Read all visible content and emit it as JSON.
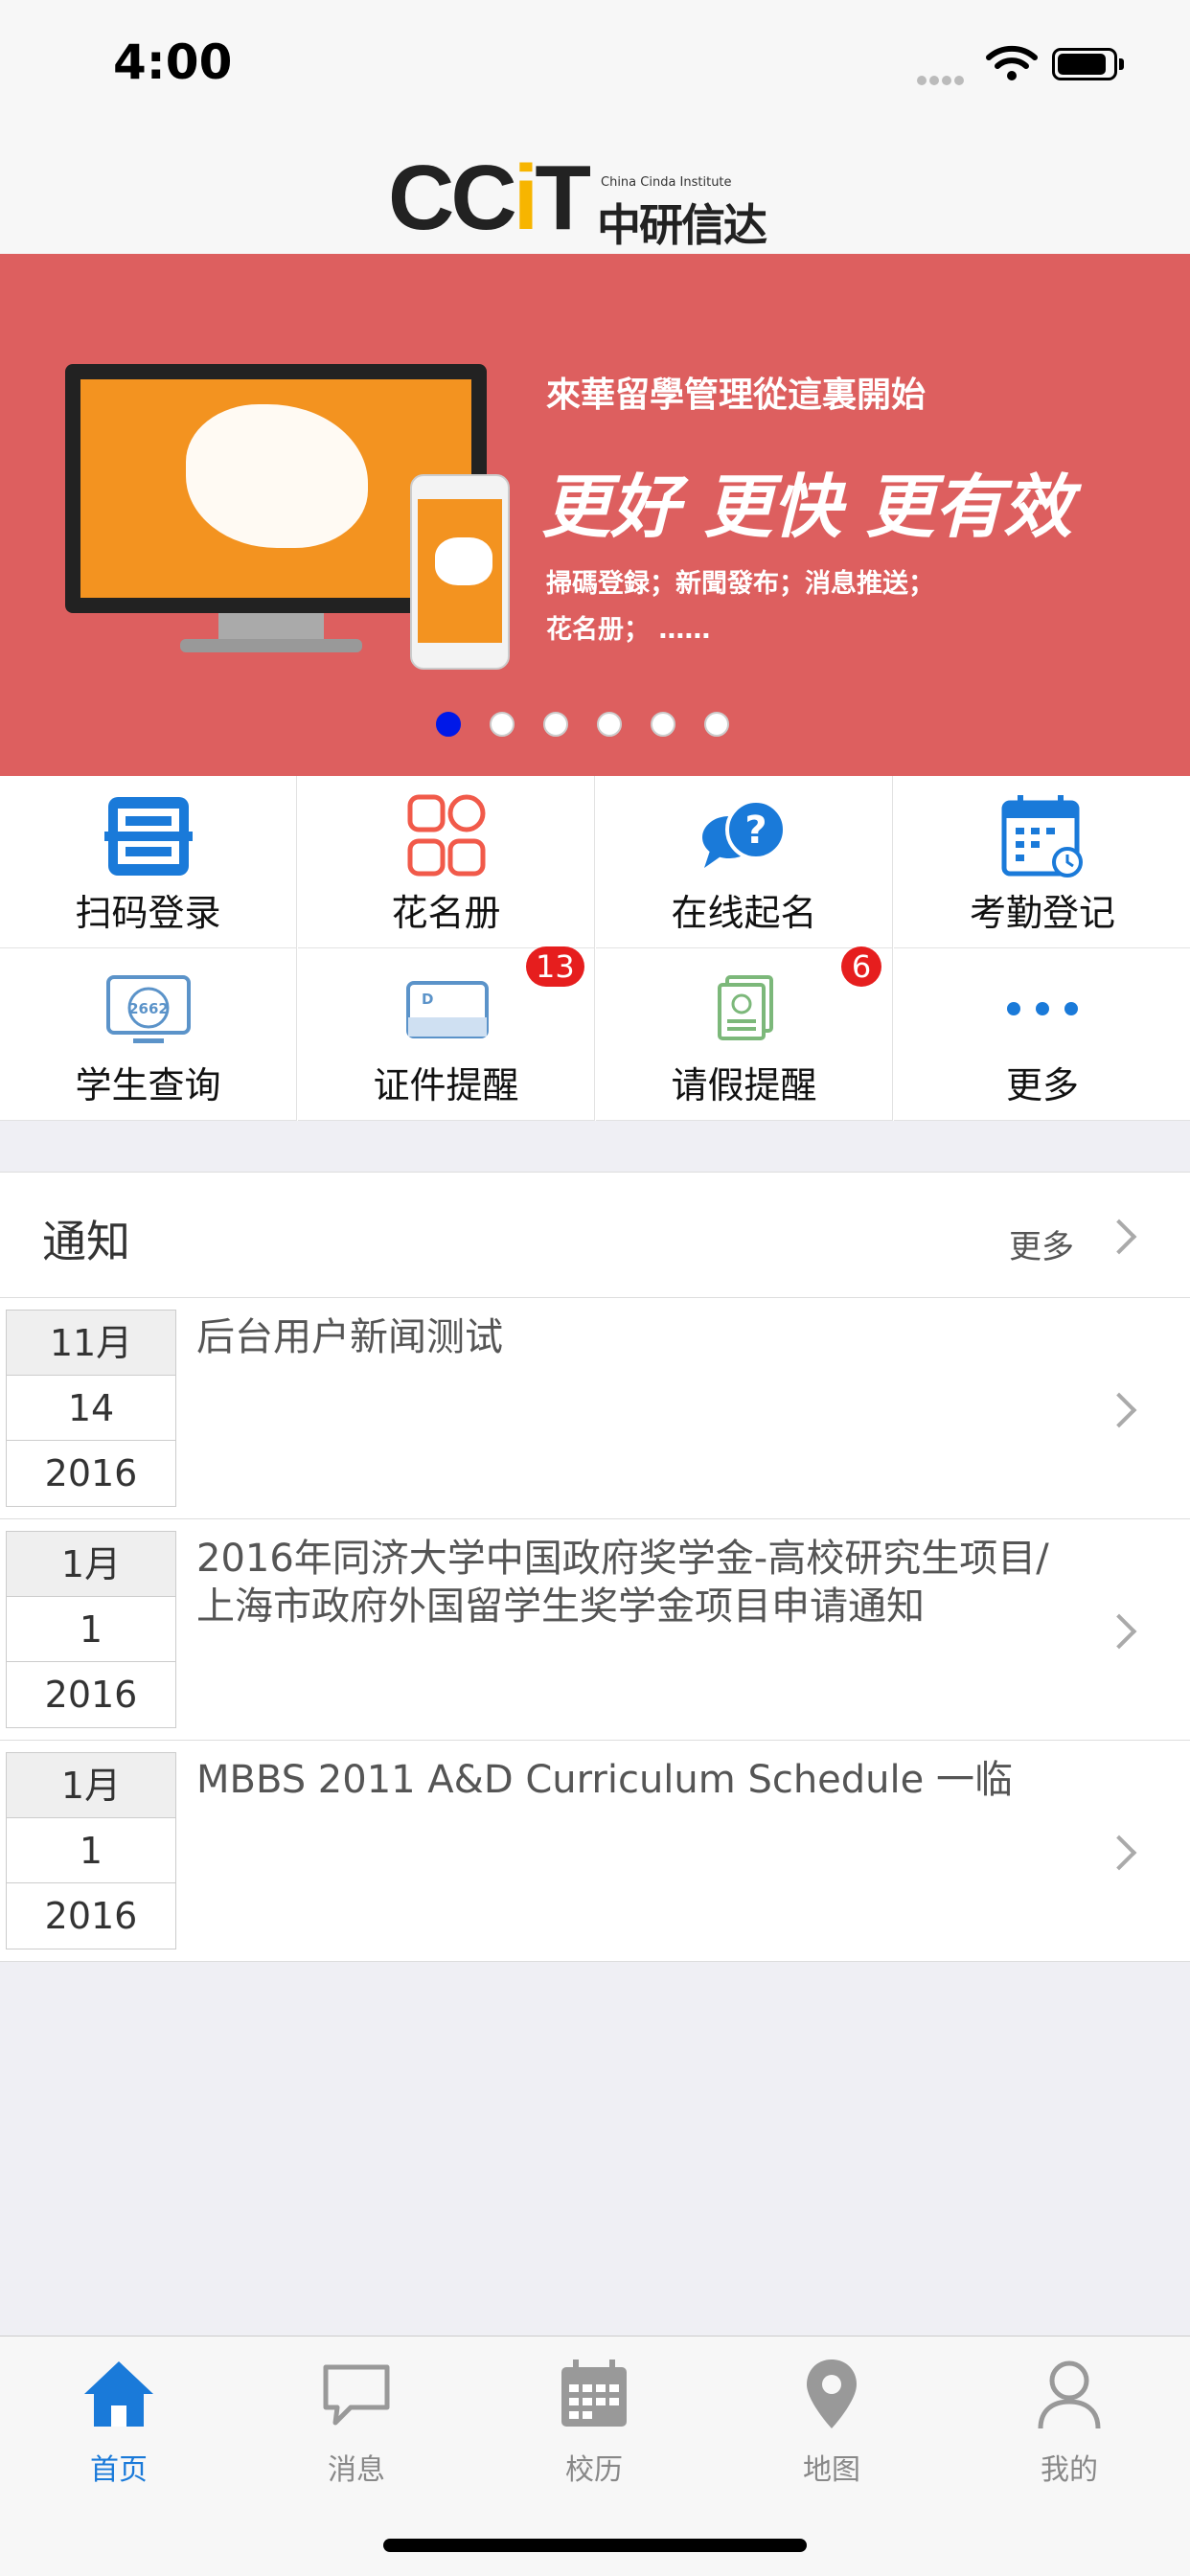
{
  "status_bar": {
    "time": "4:00"
  },
  "header": {
    "logo_letters_left": "CC",
    "logo_letter_i": "i",
    "logo_letter_t": "T",
    "logo_en": "China Cinda Institute",
    "logo_cn": "中研信达"
  },
  "banner": {
    "title": "來華留學管理從這裏開始",
    "slogan": "更好 更快 更有效",
    "line1": "掃碼登録；新聞發布；消息推送；",
    "line2": "花名册；  ……",
    "page_count": 6,
    "active_page": 1
  },
  "grid": {
    "items": [
      {
        "label": "扫码登录",
        "icon": "scan-icon"
      },
      {
        "label": "花名册",
        "icon": "grid-icon"
      },
      {
        "label": "在线起名",
        "icon": "question-chat-icon"
      },
      {
        "label": "考勤登记",
        "icon": "calendar-clock-icon"
      },
      {
        "label": "学生查询",
        "icon": "student-search-icon",
        "code": "2662"
      },
      {
        "label": "证件提醒",
        "icon": "id-card-icon",
        "badge": "13"
      },
      {
        "label": "请假提醒",
        "icon": "leave-note-icon",
        "badge": "6"
      },
      {
        "label": "更多",
        "icon": "more-dots-icon"
      }
    ]
  },
  "notice": {
    "title": "通知",
    "more_label": "更多",
    "items": [
      {
        "month": "11月",
        "day": "14",
        "year": "2016",
        "title": "后台用户新闻测试"
      },
      {
        "month": "1月",
        "day": "1",
        "year": "2016",
        "title": "2016年同济大学中国政府奖学金-高校研究生项目/ 上海市政府外国留学生奖学金项目申请通知"
      },
      {
        "month": "1月",
        "day": "1",
        "year": "2016",
        "title": "MBBS 2011 A&D Curriculum Schedule 一临"
      }
    ]
  },
  "tabbar": {
    "tabs": [
      {
        "label": "首页",
        "icon": "home-icon",
        "active": true
      },
      {
        "label": "消息",
        "icon": "message-icon"
      },
      {
        "label": "校历",
        "icon": "calendar-icon"
      },
      {
        "label": "地图",
        "icon": "map-pin-icon"
      },
      {
        "label": "我的",
        "icon": "user-icon"
      }
    ]
  },
  "colors": {
    "banner_bg": "#dd5f5f",
    "accent_blue": "#1a7ad9",
    "badge_red": "#e61e1e",
    "dot_active": "#0018e8"
  }
}
